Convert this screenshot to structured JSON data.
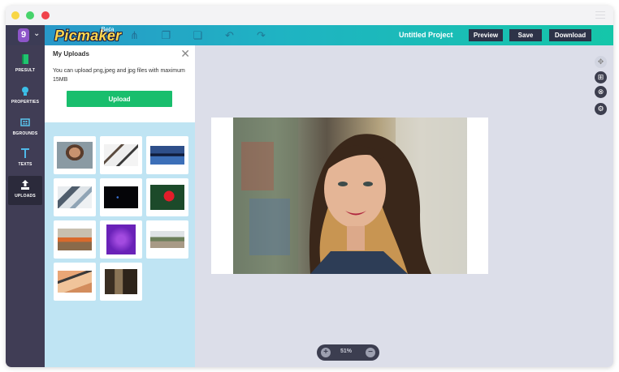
{
  "app": {
    "brand": "Picmaker",
    "beta": "Beta",
    "logo_glyph": "9",
    "project_title": "Untitled Project"
  },
  "toolbar": {
    "preview_label": "Preview",
    "save_label": "Save",
    "download_label": "Download",
    "icons": [
      "connect-icon",
      "copy-icon",
      "paste-icon",
      "undo-icon",
      "redo-icon"
    ]
  },
  "nav": {
    "items": [
      {
        "label": "PRESULT",
        "icon": "book-icon"
      },
      {
        "label": "PROPERTIES",
        "icon": "bulb-icon"
      },
      {
        "label": "BGROUNDS",
        "icon": "grid-icon"
      },
      {
        "label": "TEXTS",
        "icon": "text-icon"
      },
      {
        "label": "UPLOADS",
        "icon": "upload-icon"
      }
    ],
    "active": "UPLOADS"
  },
  "uploads": {
    "title": "My Uploads",
    "description": "You can upload png,jpeg and jpg files with maximum 15MB",
    "button_label": "Upload",
    "close": "✕"
  },
  "canvas": {
    "zoom": "51%",
    "zoom_in": "+",
    "zoom_out": "−"
  },
  "colors": {
    "topbar_start": "#2a93c9",
    "topbar_end": "#15c6a9",
    "upload_button": "#19be6d",
    "brand_yellow": "#ffd84d"
  }
}
